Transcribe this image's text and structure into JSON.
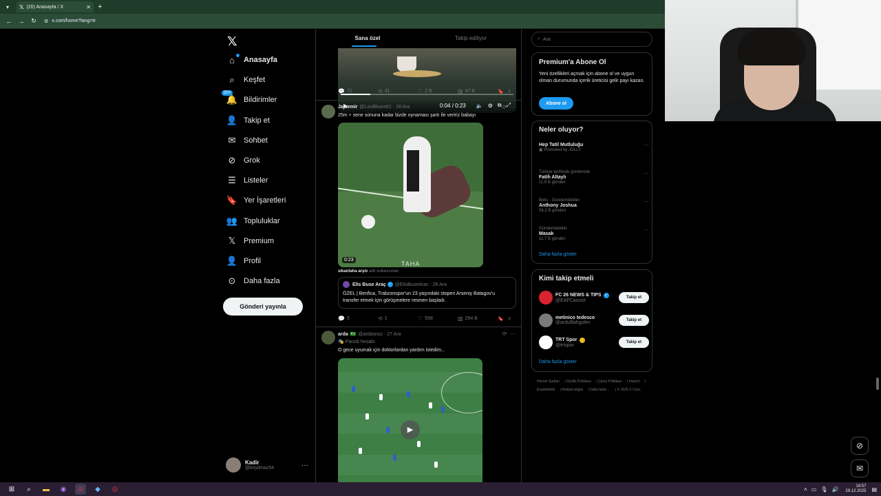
{
  "browser": {
    "tab_title": "(20) Anasayfa / X",
    "url": "x.com/home?lang=tr"
  },
  "nav": {
    "items": [
      {
        "label": "Anasayfa",
        "icon": "home-icon"
      },
      {
        "label": "Keşfet",
        "icon": "search-icon"
      },
      {
        "label": "Bildirimler",
        "icon": "bell-icon",
        "badge": "20+"
      },
      {
        "label": "Takip et",
        "icon": "person-add-icon"
      },
      {
        "label": "Sohbet",
        "icon": "mail-icon"
      },
      {
        "label": "Grok",
        "icon": "grok-icon"
      },
      {
        "label": "Listeler",
        "icon": "list-icon"
      },
      {
        "label": "Yer İşaretleri",
        "icon": "bookmark-icon"
      },
      {
        "label": "Topluluklar",
        "icon": "communities-icon"
      },
      {
        "label": "Premium",
        "icon": "x-logo-icon"
      },
      {
        "label": "Profil",
        "icon": "profile-icon"
      },
      {
        "label": "Daha fazla",
        "icon": "more-circle-icon"
      }
    ],
    "post_button": "Gönderi yayınla",
    "profile": {
      "name": "Kadir",
      "handle": "@knyilmaz54"
    }
  },
  "feed": {
    "tabs": [
      "Sana özel",
      "Takip ediliyor"
    ],
    "first_video": {
      "time": "0:04 / 0:23",
      "progress": 0.17
    },
    "first_actions": {
      "replies": "71",
      "reposts": "41",
      "likes": "2 B",
      "views": "47 B"
    },
    "tweet2": {
      "name": "Jajaemir",
      "handle": "@LouBloom61",
      "date": "28 Ara",
      "text": "25m + sene sonuna kadar bizde oynaması şartı ile veririz babayı",
      "duration": "0:23",
      "watermark": "TAHA",
      "caption_user": "sikantaha arşiv",
      "caption_suffix": "adlı kullanıcıdan",
      "quote": {
        "name": "Elis Buse Araç",
        "handle": "@ElisBuseArac",
        "date": "26 Ara",
        "text": "ÖZEL | Benfica, Trabzonspor'un 23 yaşındaki stoperi Arseniy Batagov'u transfer etmek için görüşmelere resmen başladı."
      },
      "actions": {
        "replies": "5",
        "reposts": "1",
        "likes": "558",
        "views": "264 B"
      }
    },
    "tweet3": {
      "name": "arda",
      "flag": "🇧🇷",
      "handle": "@ardasnzz",
      "date": "27 Ara",
      "parody": "Parodi hesabı",
      "text": "O gece uyumak için doktorlardan yardım istedim..."
    }
  },
  "sidebar": {
    "search_placeholder": "Ara",
    "premium": {
      "title": "Premium'a Abone Ol",
      "text": "Yeni özellikleri açmak için abone ol ve uygun olman durumunda içerik üreticisi gelir payı kazan.",
      "button": "Abone ol"
    },
    "trends_title": "Neler oluyor?",
    "trends": [
      {
        "category": "Promoted by JOLLY",
        "title": "Hep Tatil Mutluluğu",
        "count": ""
      },
      {
        "category": "Türkiye tarihinde gündemde",
        "title": "Fatih Altaylı",
        "count": "11,9 B gönderi"
      },
      {
        "category": "Boks · Gündemdekiler",
        "title": "Anthony Joshua",
        "count": "56,3 B gönderi"
      },
      {
        "category": "Gündemdekiler",
        "title": "Masak",
        "count": "11,7 B gönderi"
      }
    ],
    "show_more": "Daha fazla göster",
    "who_title": "Kimi takip etmeli",
    "who": [
      {
        "name": "FC 26 NEWS & TIPS",
        "handle": "@EAFCassist",
        "avatar_color": "#d9232e",
        "badge": "blue"
      },
      {
        "name": "metinico tedesco",
        "handle": "@ardulllahgulen",
        "avatar_color": "#7a7a7a",
        "badge": ""
      },
      {
        "name": "TRT Spor",
        "handle": "@trtspor",
        "avatar_color": "#ffffff",
        "badge": "gold"
      }
    ],
    "follow_label": "Takip et",
    "footer": [
      "Hizmet Şartları",
      "Gizlilik Politikası",
      "Çerez Politikası",
      "Imprint",
      "Erişilebilirlik",
      "Reklam bilgisi",
      "Daha fazla ...",
      "© 2025 X Corp."
    ]
  },
  "taskbar": {
    "time": "18:57",
    "date": "29.12.2025"
  }
}
